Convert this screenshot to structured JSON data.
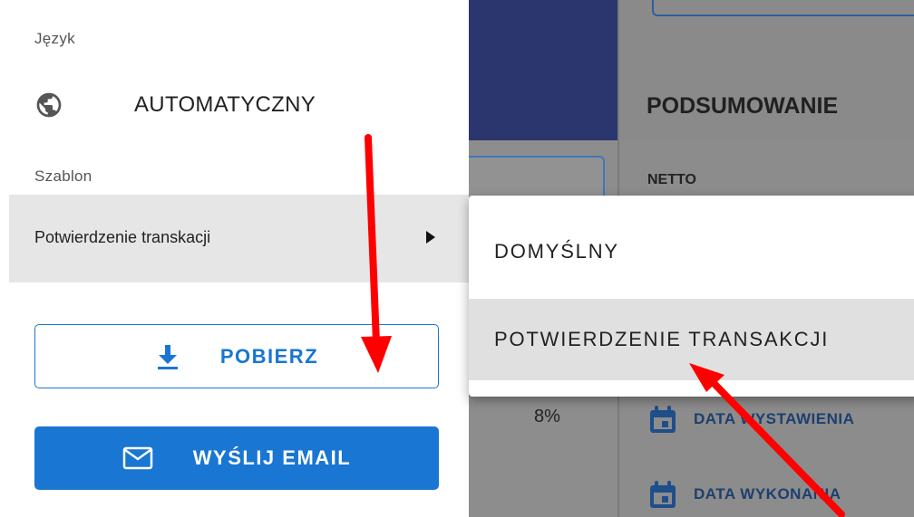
{
  "panel": {
    "language_label": "Język",
    "language_value": "AUTOMATYCZNY",
    "template_label": "Szablon",
    "template_value": "Potwierdzenie transkacji",
    "download_button": "POBIERZ",
    "email_button": "WYŚLIJ EMAIL"
  },
  "submenu": {
    "items": [
      "DOMYŚLNY",
      "POTWIERDZENIE TRANSAKCJI"
    ],
    "selected_index": 1
  },
  "background": {
    "summary_title": "PODSUMOWANIE",
    "netto_label": "NETTO",
    "percent_value": "8%",
    "date_issued_label": "DATA WYSTAWIENIA",
    "date_executed_label": "DATA WYKONANIA"
  },
  "colors": {
    "primary": "#1976d2",
    "annotation": "#ff0000",
    "header_band": "#2b356e"
  },
  "icons": {
    "language": "globe-icon",
    "template_expand": "triangle-right-icon",
    "download": "download-icon",
    "email": "email-icon",
    "date": "calendar-icon"
  }
}
